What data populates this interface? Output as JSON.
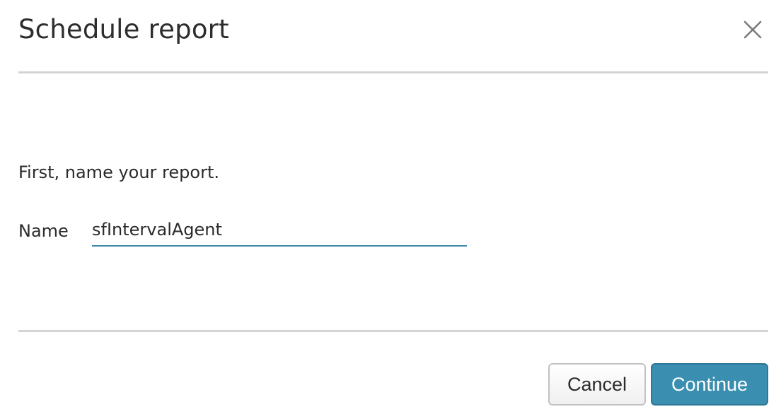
{
  "dialog": {
    "title": "Schedule report",
    "close_icon": "close-icon"
  },
  "form": {
    "prompt": "First, name your report.",
    "name_label": "Name",
    "name_value": "sfIntervalAgent"
  },
  "footer": {
    "cancel_label": "Cancel",
    "continue_label": "Continue"
  },
  "colors": {
    "accent": "#3a8fb0",
    "input_underline": "#3b88b0",
    "divider": "#d4d4d4"
  }
}
